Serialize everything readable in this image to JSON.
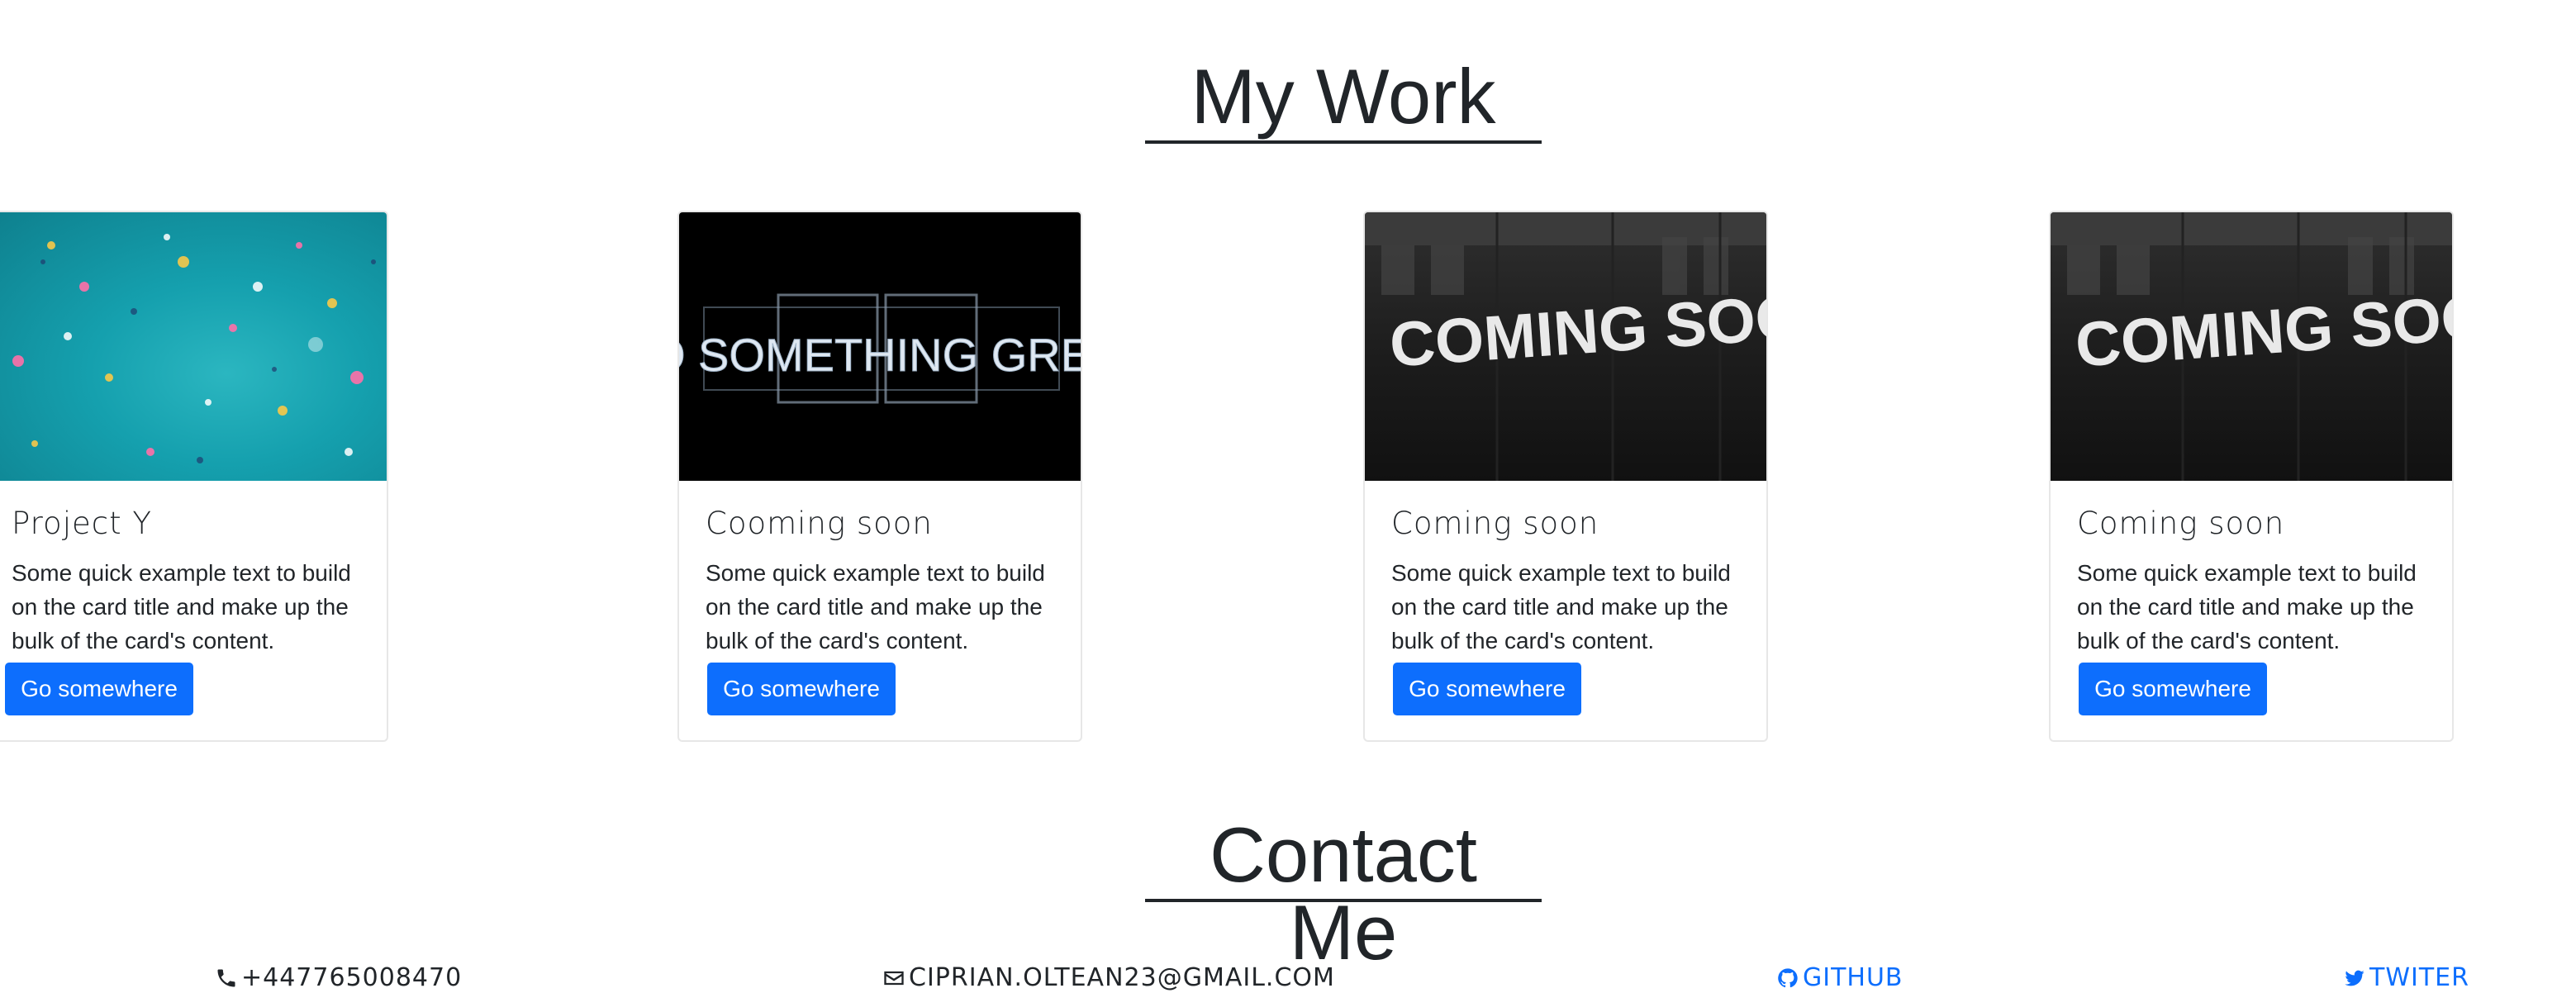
{
  "work": {
    "title": "My Work",
    "cards": [
      {
        "title": "Project Y",
        "text": "Some quick example text to build on the card title and make up the bulk of the card's content.",
        "button": "Go somewhere",
        "image": "confetti"
      },
      {
        "title": "Cooming soon",
        "text": "Some quick example text to build on the card title and make up the bulk of the card's content.",
        "button": "Go somewhere",
        "image": "neon-do-something-great",
        "image_text": "DO SOMETHING GREAT"
      },
      {
        "title": "Coming soon",
        "text": "Some quick example text to build on the card title and make up the bulk of the card's content.",
        "button": "Go somewhere",
        "image": "coming-soon",
        "image_text": "COMING SOON"
      },
      {
        "title": "Coming soon",
        "text": "Some quick example text to build on the card title and make up the bulk of the card's content.",
        "button": "Go somewhere",
        "image": "coming-soon",
        "image_text": "COMING SOON"
      }
    ]
  },
  "contact": {
    "title": "Contact Me",
    "phone": {
      "icon": "phone-icon",
      "label": "+447765008470"
    },
    "email": {
      "icon": "envelope-icon",
      "label": "CIPRIAN.OLTEAN23@GMAIL.COM"
    },
    "github": {
      "icon": "github-icon",
      "label": "GITHUB"
    },
    "twitter": {
      "icon": "twitter-icon",
      "label": "TWITER"
    }
  },
  "colors": {
    "accent": "#0d6efd",
    "text": "#212529"
  }
}
